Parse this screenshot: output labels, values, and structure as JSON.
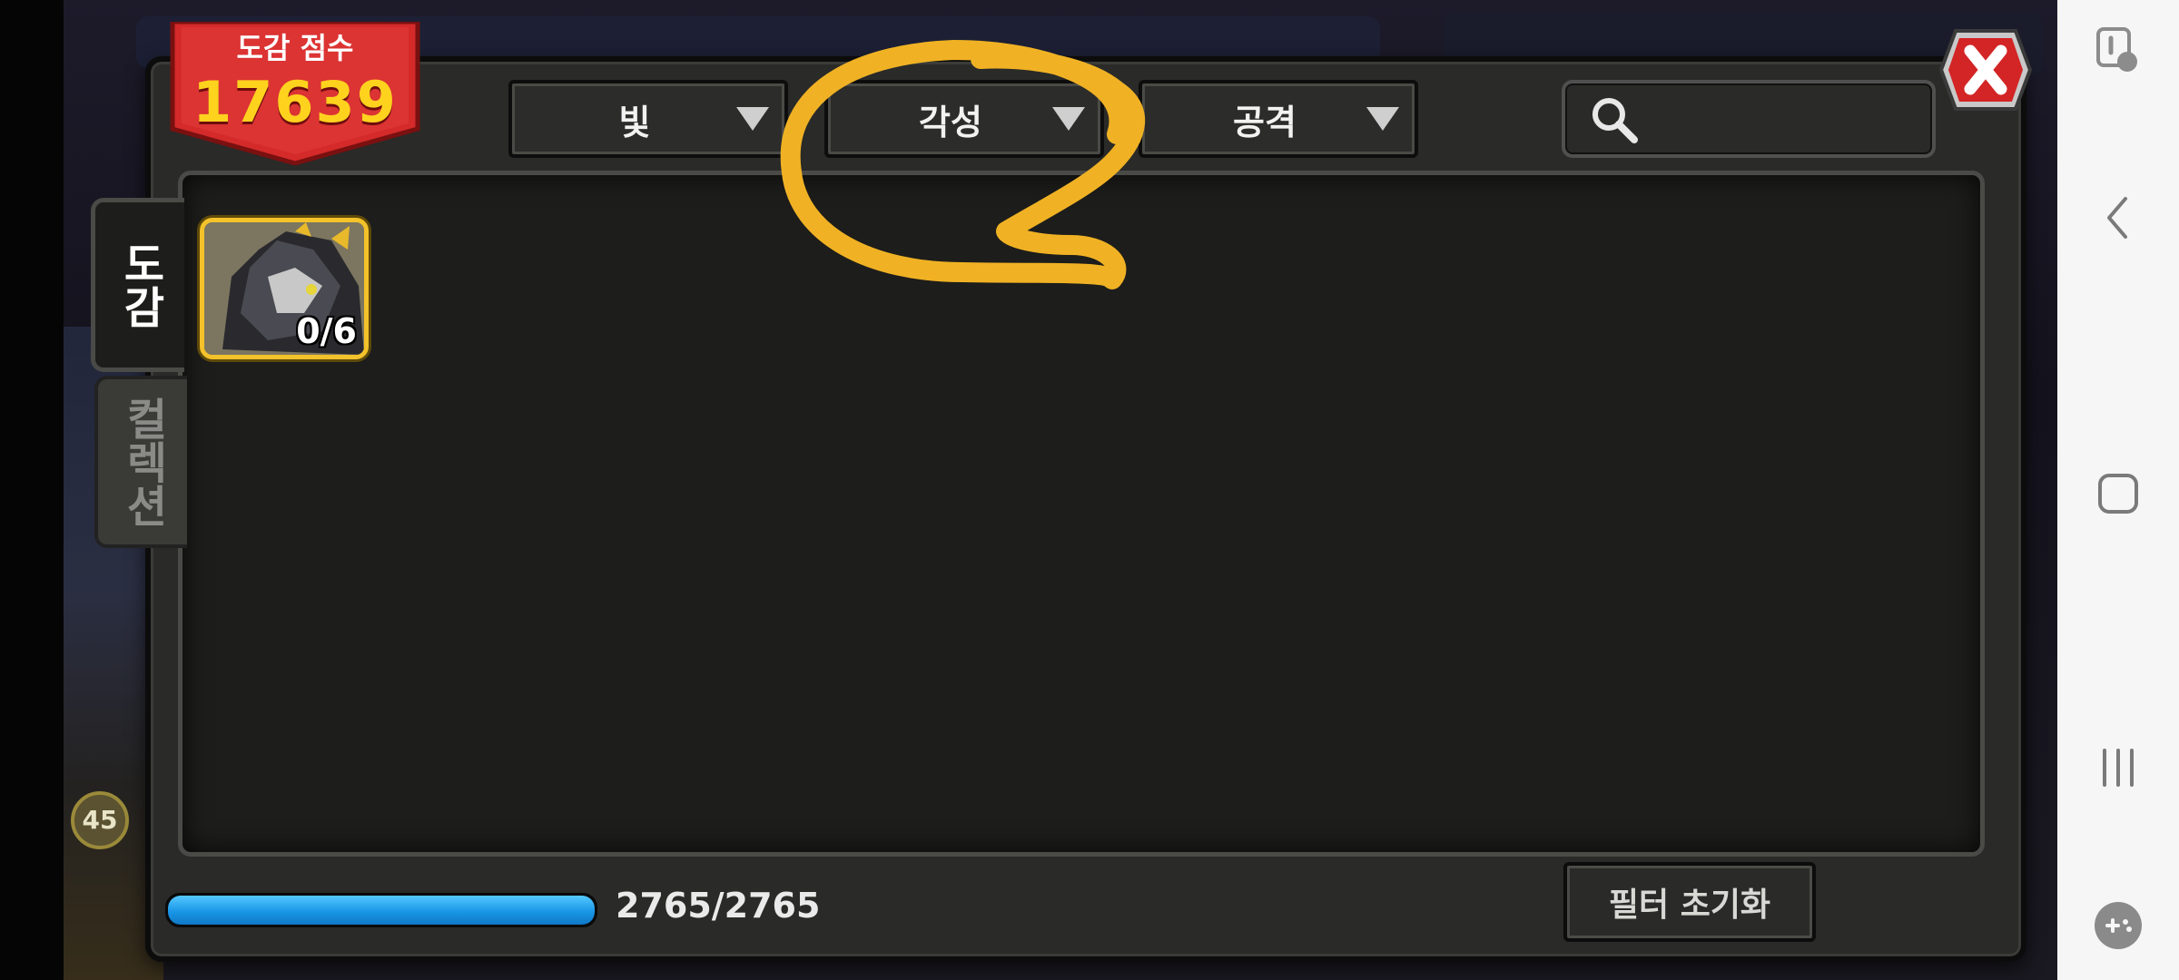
{
  "header": {
    "score_label": "도감 점수",
    "score_value": "17639"
  },
  "filters": [
    {
      "label": "빛"
    },
    {
      "label": "각성"
    },
    {
      "label": "공격"
    }
  ],
  "search": {
    "icon": "search-icon",
    "value": ""
  },
  "tabs": [
    {
      "label": "도감",
      "active": true
    },
    {
      "label": "컬렉션",
      "active": false
    }
  ],
  "items": [
    {
      "count": "0/6",
      "icon": "dark-dragon-portrait"
    }
  ],
  "progress": {
    "text": "2765/2765",
    "fraction": 1.0
  },
  "buttons": {
    "reset": "필터 초기화",
    "close_icon": "close-icon"
  },
  "background": {
    "badge": "45"
  },
  "colors": {
    "banner_red": "#d42a2a",
    "score_gold": "#ffd21e",
    "card_border": "#f4c22a",
    "progress_blue": "#1996e6",
    "annotation": "#f0b224"
  }
}
